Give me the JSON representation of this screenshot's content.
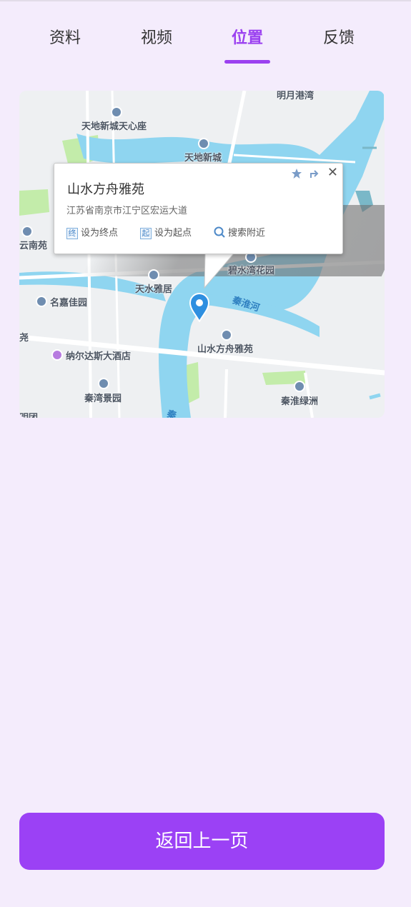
{
  "tabs": [
    {
      "label": "资料",
      "active": false
    },
    {
      "label": "视频",
      "active": false
    },
    {
      "label": "位置",
      "active": true
    },
    {
      "label": "反馈",
      "active": false
    }
  ],
  "map": {
    "pois": {
      "mingyue": "明月港湾",
      "tiandi_center": "天地新城天心座",
      "tiandi": "天地新城",
      "yunnan": "云南苑",
      "bishui": "碧水湾花园",
      "tianshui": "天水雅居",
      "mingjia": "名嘉佳园",
      "shanshui": "山水方舟雅苑",
      "narsdas": "纳尔达斯大酒店",
      "qinwan": "秦湾景园",
      "qinhuai_green": "秦淮绿洲",
      "left_edge_1": "尧",
      "left_edge_2": "明团"
    },
    "river_label": "秦淮河",
    "river_label_2": "秦"
  },
  "popup": {
    "title": "山水方舟雅苑",
    "address": "江苏省南京市江宁区宏运大道",
    "actions": [
      {
        "badge": "终",
        "label": "设为终点"
      },
      {
        "badge": "起",
        "label": "设为起点"
      },
      {
        "label": "搜索附近"
      }
    ],
    "close_symbol": "✕"
  },
  "back_button": {
    "label": "返回上一页"
  },
  "colors": {
    "accent": "#9b41f0",
    "background": "#f4ecfc",
    "water": "#8fd5f0",
    "green": "#c3ecaa",
    "marker": "#2e8fe0"
  }
}
